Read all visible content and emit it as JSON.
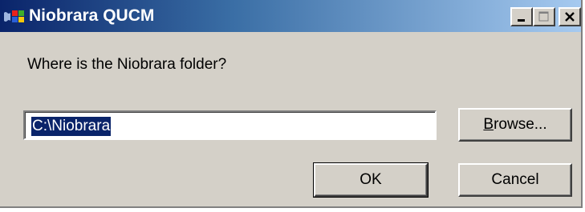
{
  "window": {
    "title": "Niobrara QUCM"
  },
  "titlebar": {
    "minimize_icon": "minimize-icon",
    "maximize_icon": "maximize-icon",
    "close_icon": "close-icon"
  },
  "dialog": {
    "prompt": "Where is the Niobrara folder?",
    "path_value": "C:\\Niobrara",
    "browse_label_accel": "B",
    "browse_label_rest": "rowse...",
    "ok_label": "OK",
    "cancel_label": "Cancel"
  },
  "colors": {
    "titlebar_start": "#0a246a",
    "titlebar_end": "#a6caf0",
    "face": "#d4d0c8",
    "selection": "#0a246a"
  }
}
